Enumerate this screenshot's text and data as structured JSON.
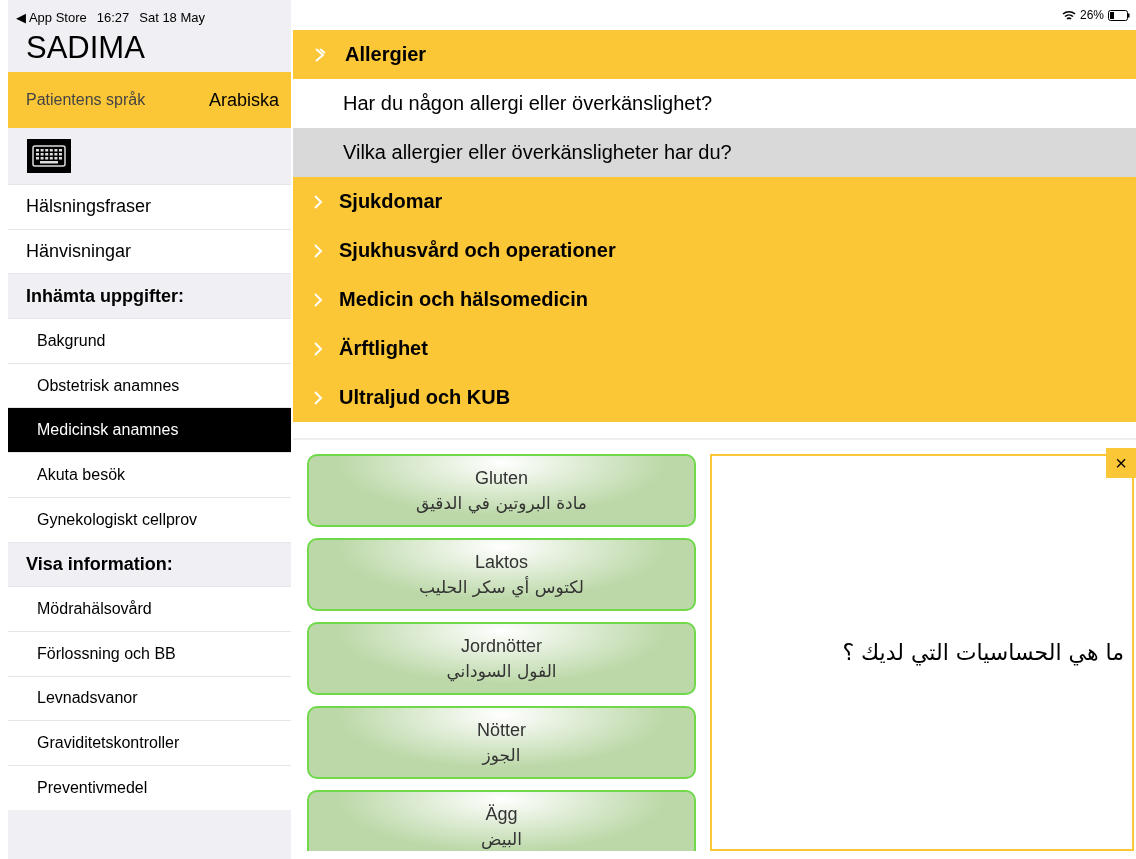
{
  "status_bar": {
    "back": "◀ App Store",
    "time": "16:27",
    "date": "Sat 18 May",
    "battery": "26%"
  },
  "sidebar": {
    "title": "SADIMA",
    "language": {
      "label": "Patientens språk",
      "value": "Arabiska"
    },
    "items": [
      {
        "kind": "link",
        "label": "Hälsningsfraser",
        "selected": false
      },
      {
        "kind": "link",
        "label": "Hänvisningar",
        "selected": false
      },
      {
        "kind": "header",
        "label": "Inhämta uppgifter:",
        "selected": false
      },
      {
        "kind": "sub",
        "label": "Bakgrund",
        "selected": false
      },
      {
        "kind": "sub",
        "label": "Obstetrisk anamnes",
        "selected": false
      },
      {
        "kind": "sub",
        "label": "Medicinsk anamnes",
        "selected": true
      },
      {
        "kind": "sub",
        "label": "Akuta besök",
        "selected": false
      },
      {
        "kind": "sub",
        "label": "Gynekologiskt cellprov",
        "selected": false
      },
      {
        "kind": "header",
        "label": "Visa information:",
        "selected": false
      },
      {
        "kind": "sub",
        "label": "Mödrahälsovård",
        "selected": false
      },
      {
        "kind": "sub",
        "label": "Förlossning och BB",
        "selected": false
      },
      {
        "kind": "sub",
        "label": "Levnadsvanor",
        "selected": false
      },
      {
        "kind": "sub",
        "label": "Graviditetskontroller",
        "selected": false
      },
      {
        "kind": "sub",
        "label": "Preventivmedel",
        "selected": false
      }
    ]
  },
  "sections": [
    {
      "title": "Allergier",
      "expanded": true,
      "questions": [
        {
          "text": "Har du någon allergi eller överkänslighet?",
          "selected": false
        },
        {
          "text": "Vilka allergier eller överkänsligheter har du?",
          "selected": true
        }
      ]
    },
    {
      "title": "Sjukdomar",
      "expanded": false
    },
    {
      "title": "Sjukhusvård och operationer",
      "expanded": false
    },
    {
      "title": "Medicin och hälsomedicin",
      "expanded": false
    },
    {
      "title": "Ärftlighet",
      "expanded": false
    },
    {
      "title": "Ultraljud och KUB",
      "expanded": false
    }
  ],
  "answers": [
    {
      "swedish": "Gluten",
      "arabic": "مادة البروتين في الدقيق"
    },
    {
      "swedish": "Laktos",
      "arabic": "لكتوس أي سكر الحليب"
    },
    {
      "swedish": "Jordnötter",
      "arabic": "الفول السوداني"
    },
    {
      "swedish": "Nötter",
      "arabic": "الجوز"
    },
    {
      "swedish": "Ägg",
      "arabic": "البيض"
    }
  ],
  "translation": {
    "text": "ما هي الحساسيات التي لديك ؟",
    "close": "×"
  }
}
